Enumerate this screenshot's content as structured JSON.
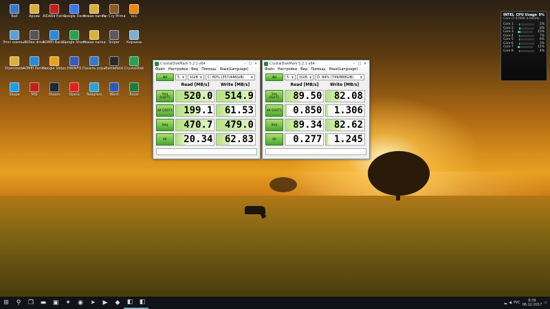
{
  "desktop": {
    "icons": [
      {
        "label": "Ball",
        "color": "#3a78c8"
      },
      {
        "label": "Архив",
        "color": "#d8b040"
      },
      {
        "label": "AIDA64 Extreme",
        "color": "#c02020"
      },
      {
        "label": "Google Docs",
        "color": "#3a78e8"
      },
      {
        "label": "Новая папка",
        "color": "#d8b040"
      },
      {
        "label": "Far Cry Primal",
        "color": "#8a5a2a"
      },
      {
        "label": "VLC",
        "color": "#e88a10"
      },
      {
        "label": "Этот компьютер",
        "color": "#5aa0d8"
      },
      {
        "label": "300ex drive",
        "color": "#555"
      },
      {
        "label": "AOMEI Backupper",
        "color": "#2a8ad8"
      },
      {
        "label": "Google Sheets",
        "color": "#2aa050"
      },
      {
        "label": "Новая папка",
        "color": "#d8b040"
      },
      {
        "label": "Sniper",
        "color": "#5a5a5a"
      },
      {
        "label": "Корзина",
        "color": "#7ab0d8"
      },
      {
        "label": "Downloads",
        "color": "#d8b040"
      },
      {
        "label": "AOMEI Partition",
        "color": "#2a8ad8"
      },
      {
        "label": "Google Slides",
        "color": "#e8a020"
      },
      {
        "label": "HWiNFO",
        "color": "#3a5ab8"
      },
      {
        "label": "Панель управления",
        "color": "#3a78c8"
      },
      {
        "label": "Battlefield",
        "color": "#2a2a2a"
      },
      {
        "label": "CrystalDisk",
        "color": "#2aa050"
      },
      {
        "label": "Skype",
        "color": "#1aa0e8"
      },
      {
        "label": "MSI",
        "color": "#c02020"
      },
      {
        "label": "Steam",
        "color": "#1b2838"
      },
      {
        "label": "Opera",
        "color": "#e02020"
      },
      {
        "label": "Telegram",
        "color": "#2aa0d8"
      },
      {
        "label": "Word",
        "color": "#2a5ab8"
      },
      {
        "label": "Excel",
        "color": "#207a40"
      }
    ]
  },
  "cpu_gadget": {
    "title": "CPU Usage",
    "total": "9%",
    "cpu_line": "Core i7-4790K 4.00GHz",
    "brand": "INTEL",
    "cores": [
      {
        "name": "Core 1",
        "value": "2%",
        "level": 0.02
      },
      {
        "name": "Core 2",
        "value": "8%",
        "level": 0.08
      },
      {
        "name": "Core 3",
        "value": "15%",
        "level": 0.15
      },
      {
        "name": "Core 4",
        "value": "7%",
        "level": 0.07
      },
      {
        "name": "Core 5",
        "value": "6%",
        "level": 0.06
      },
      {
        "name": "Core 6",
        "value": "3%",
        "level": 0.03
      },
      {
        "name": "Core 7",
        "value": "11%",
        "level": 0.11
      },
      {
        "name": "Core 8",
        "value": "4%",
        "level": 0.04
      }
    ]
  },
  "windows": [
    {
      "title": "CrystalDiskMark 5.2.1 x64",
      "menu": [
        "Файл",
        "Настройки",
        "Вид",
        "Помощь",
        "Язык(Language)"
      ],
      "all_label": "All",
      "count": "5",
      "size": "1GiB",
      "drive": "C: 80% (357/446GiB)",
      "read_header": "Read [MB/s]",
      "write_header": "Write [MB/s]",
      "rows": [
        {
          "label": "Seq Q32T1",
          "read": "520.0",
          "write": "514.9",
          "read_level": 0.95,
          "write_level": 0.94
        },
        {
          "label": "4K Q32T1",
          "read": "199.1",
          "write": "61.53",
          "read_level": 0.6,
          "write_level": 0.35
        },
        {
          "label": "Seq",
          "read": "470.7",
          "write": "479.0",
          "read_level": 0.92,
          "write_level": 0.92
        },
        {
          "label": "4K",
          "read": "20.34",
          "write": "62.83",
          "read_level": 0.25,
          "write_level": 0.35
        }
      ]
    },
    {
      "title": "CrystalDiskMark 5.2.1 x64",
      "menu": [
        "Файл",
        "Настройки",
        "Вид",
        "Помощь",
        "Язык(Language)"
      ],
      "all_label": "All",
      "count": "5",
      "size": "1GiB",
      "drive": "D: 84% (749/888GiB)",
      "read_header": "Read [MB/s]",
      "write_header": "Write [MB/s]",
      "rows": [
        {
          "label": "Seq Q32T1",
          "read": "89.50",
          "write": "82.08",
          "read_level": 0.4,
          "write_level": 0.38
        },
        {
          "label": "4K Q32T1",
          "read": "0.850",
          "write": "1.306",
          "read_level": 0.05,
          "write_level": 0.07
        },
        {
          "label": "Seq",
          "read": "89.34",
          "write": "82.62",
          "read_level": 0.4,
          "write_level": 0.38
        },
        {
          "label": "4K",
          "read": "0.277",
          "write": "1.245",
          "read_level": 0.03,
          "write_level": 0.07
        }
      ]
    }
  ],
  "taskbar": {
    "icons": [
      "start-icon",
      "search-icon",
      "task-view-icon",
      "file-explorer-icon",
      "store-icon",
      "antivirus-icon",
      "chrome-icon",
      "telegram-icon",
      "youtube-icon",
      "aida-icon",
      "crystaldiskmark-icon",
      "crystaldiskmark-icon"
    ],
    "language": "РУС",
    "time": "8:39",
    "date": "06.12.2017"
  },
  "colors": {
    "green_button": "#4aa52a",
    "bar_fill": "#b6e27f"
  }
}
